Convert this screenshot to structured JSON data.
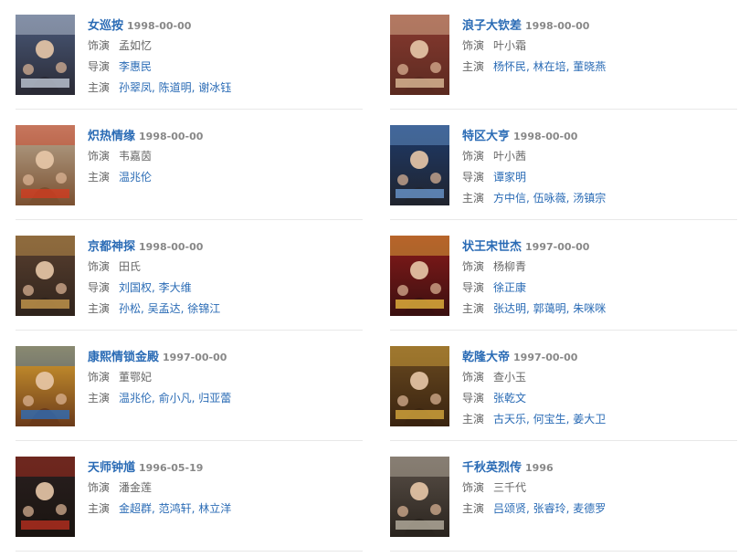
{
  "movies": [
    {
      "title": "女巡按",
      "date": "1998-00-00",
      "playing": {
        "label": "饰演",
        "value": "孟如忆"
      },
      "director": {
        "label": "导演",
        "value": "李惠民"
      },
      "cast": {
        "label": "主演",
        "value": "孙翠凤, 陈道明, 谢冰钰"
      },
      "poster": {
        "bg": "#4a5a7a",
        "accent": "#c9d3e0",
        "figure": "#2a2a35"
      }
    },
    {
      "title": "浪子大钦差",
      "date": "1998-00-00",
      "playing": {
        "label": "饰演",
        "value": "叶小霜"
      },
      "director": null,
      "cast": {
        "label": "主演",
        "value": "杨怀民, 林在培, 董晓燕"
      },
      "poster": {
        "bg": "#8a3a30",
        "accent": "#e6c6a0",
        "figure": "#5a2a20"
      }
    },
    {
      "title": "炽热情缘",
      "date": "1998-00-00",
      "playing": {
        "label": "饰演",
        "value": "韦嘉茵"
      },
      "director": null,
      "cast": {
        "label": "主演",
        "value": "温兆伦"
      },
      "poster": {
        "bg": "#b8a890",
        "accent": "#d63a1f",
        "figure": "#7a5030"
      }
    },
    {
      "title": "特区大亨",
      "date": "1998-00-00",
      "playing": {
        "label": "饰演",
        "value": "叶小茜"
      },
      "director": {
        "label": "导演",
        "value": "谭家明"
      },
      "cast": {
        "label": "主演",
        "value": "方中信, 伍咏薇, 汤镇宗"
      },
      "poster": {
        "bg": "#1e3a6a",
        "accent": "#6f9fd8",
        "figure": "#20242e"
      }
    },
    {
      "title": "京都神探",
      "date": "1998-00-00",
      "playing": {
        "label": "饰演",
        "value": "田氏"
      },
      "director": {
        "label": "导演",
        "value": "刘国权, 李大维"
      },
      "cast": {
        "label": "主演",
        "value": "孙松, 吴孟达, 徐锦江"
      },
      "poster": {
        "bg": "#5a4030",
        "accent": "#d0a050",
        "figure": "#30241c"
      }
    },
    {
      "title": "状王宋世杰",
      "date": "1997-00-00",
      "playing": {
        "label": "饰演",
        "value": "杨柳青"
      },
      "director": {
        "label": "导演",
        "value": "徐正康"
      },
      "cast": {
        "label": "主演",
        "value": "张达明, 郭蔼明, 朱咪咪"
      },
      "poster": {
        "bg": "#8a1a1a",
        "accent": "#f0c040",
        "figure": "#3a1010"
      }
    },
    {
      "title": "康熙情锁金殿",
      "date": "1997-00-00",
      "playing": {
        "label": "饰演",
        "value": "董鄂妃"
      },
      "director": null,
      "cast": {
        "label": "主演",
        "value": "温兆伦, 俞小凡, 归亚蕾"
      },
      "poster": {
        "bg": "#d8a030",
        "accent": "#2a6fc0",
        "figure": "#6a3a1a"
      }
    },
    {
      "title": "乾隆大帝",
      "date": "1997-00-00",
      "playing": {
        "label": "饰演",
        "value": "查小玉"
      },
      "director": {
        "label": "导演",
        "value": "张乾文"
      },
      "cast": {
        "label": "主演",
        "value": "古天乐, 何宝生, 姜大卫"
      },
      "poster": {
        "bg": "#6a4a20",
        "accent": "#e0b040",
        "figure": "#3a2410"
      }
    },
    {
      "title": "天师钟馗",
      "date": "1996-05-19",
      "playing": {
        "label": "饰演",
        "value": "潘金莲"
      },
      "director": null,
      "cast": {
        "label": "主演",
        "value": "金超群, 范鸿轩, 林立洋"
      },
      "poster": {
        "bg": "#2a2020",
        "accent": "#c23020",
        "figure": "#1a1410"
      }
    },
    {
      "title": "千秋英烈传",
      "date": "1996",
      "playing": {
        "label": "饰演",
        "value": "三千代"
      },
      "director": null,
      "cast": {
        "label": "主演",
        "value": "吕颂贤, 张睿玲, 麦德罗"
      },
      "poster": {
        "bg": "#5a5048",
        "accent": "#c0b8a8",
        "figure": "#2a241e"
      }
    }
  ]
}
